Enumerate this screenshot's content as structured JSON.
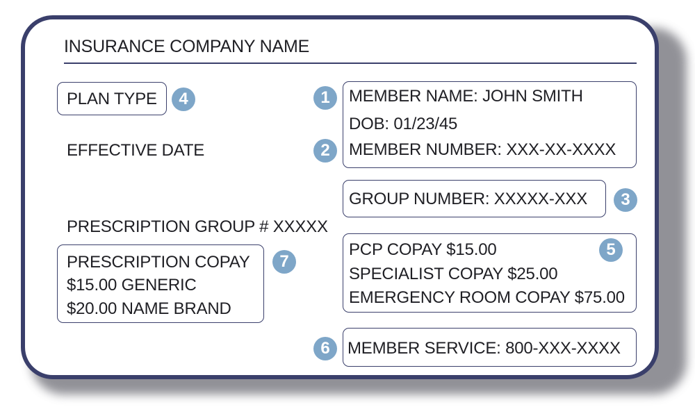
{
  "company_name": "INSURANCE COMPANY NAME",
  "plan_type": "PLAN TYPE",
  "effective_date": "EFFECTIVE DATE",
  "member": {
    "name": "MEMBER NAME: JOHN SMITH",
    "dob": "DOB: 01/23/45",
    "number": "MEMBER NUMBER: XXX-XX-XXXX"
  },
  "group_number": "GROUP NUMBER:  XXXXX-XXX",
  "prescription_group": "PRESCRIPTION GROUP # XXXXX",
  "prescription_copay": {
    "title": "PRESCRIPTION COPAY",
    "generic": "$15.00 GENERIC",
    "name_brand": "$20.00 NAME BRAND"
  },
  "copays": {
    "pcp": "PCP COPAY $15.00",
    "specialist": "SPECIALIST COPAY $25.00",
    "emergency": "EMERGENCY ROOM COPAY $75.00"
  },
  "member_service": "MEMBER SERVICE: 800-XXX-XXXX",
  "badges": {
    "one": "1",
    "two": "2",
    "three": "3",
    "four": "4",
    "five": "5",
    "six": "6",
    "seven": "7"
  },
  "colors": {
    "border": "#3a3f6b",
    "badge": "#7ea6c8",
    "text": "#1f1f24"
  }
}
